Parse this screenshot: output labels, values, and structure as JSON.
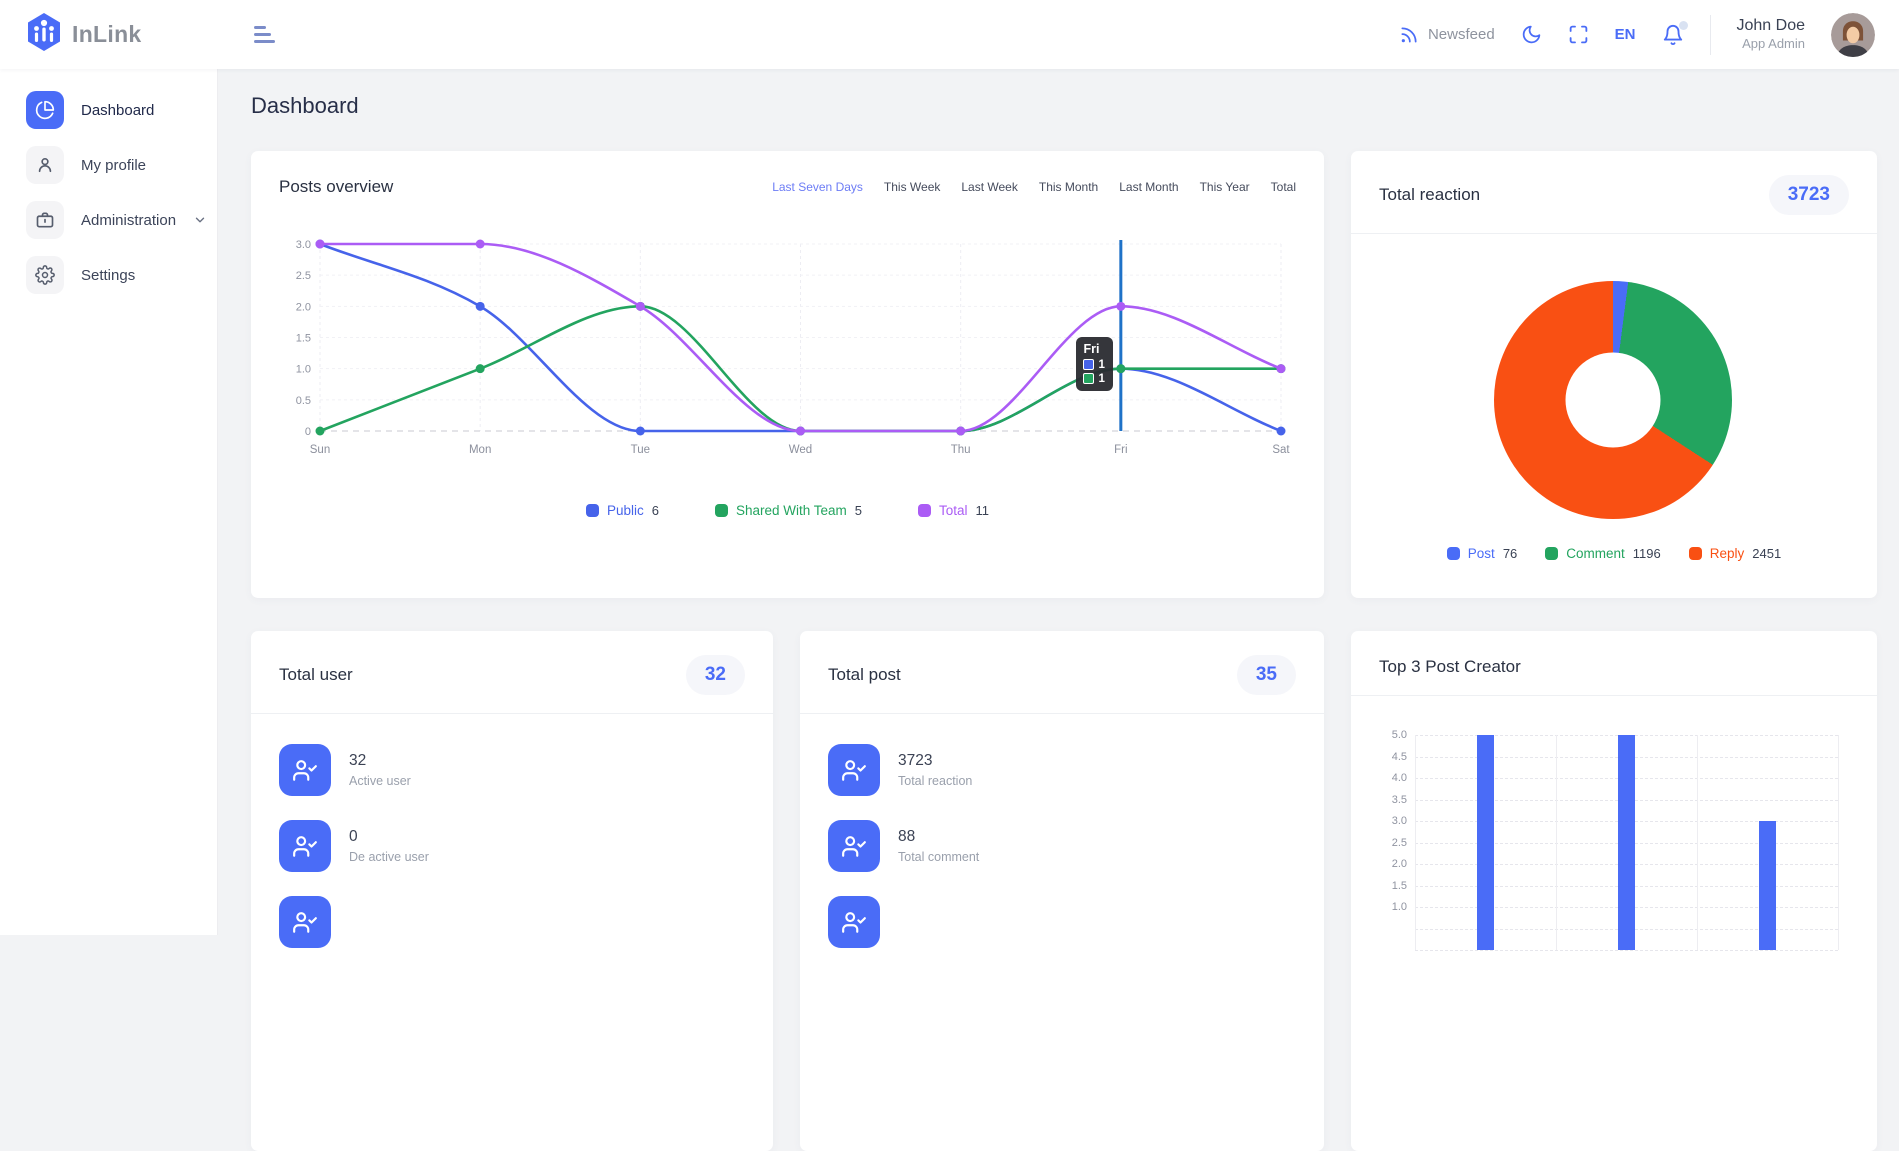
{
  "brand": {
    "name": "InLink"
  },
  "header": {
    "newsfeed_label": "Newsfeed",
    "language": "EN",
    "user": {
      "name": "John Doe",
      "role": "App Admin"
    }
  },
  "sidebar": {
    "items": [
      {
        "label": "Dashboard",
        "icon": "pie-chart-icon",
        "active": true,
        "has_submenu": false
      },
      {
        "label": "My profile",
        "icon": "user-icon",
        "active": false,
        "has_submenu": false
      },
      {
        "label": "Administration",
        "icon": "briefcase-icon",
        "active": false,
        "has_submenu": true
      },
      {
        "label": "Settings",
        "icon": "gear-icon",
        "active": false,
        "has_submenu": false
      }
    ]
  },
  "page": {
    "title": "Dashboard"
  },
  "posts_overview": {
    "title": "Posts overview",
    "filters": [
      {
        "label": "Last Seven Days",
        "active": true
      },
      {
        "label": "This Week",
        "active": false
      },
      {
        "label": "Last Week",
        "active": false
      },
      {
        "label": "This Month",
        "active": false
      },
      {
        "label": "Last Month",
        "active": false
      },
      {
        "label": "This Year",
        "active": false
      },
      {
        "label": "Total",
        "active": false
      }
    ],
    "chart_data": {
      "type": "line",
      "x": [
        "Sun",
        "Mon",
        "Tue",
        "Wed",
        "Thu",
        "Fri",
        "Sat"
      ],
      "series": [
        {
          "name": "Public",
          "color": "#4663ea",
          "values": [
            3,
            2,
            0,
            0,
            0,
            1,
            0
          ],
          "total": "6"
        },
        {
          "name": "Shared With Team",
          "color": "#23a45f",
          "values": [
            0,
            1,
            2,
            0,
            0,
            1,
            1
          ],
          "total": "5"
        },
        {
          "name": "Total",
          "color": "#ab5cf5",
          "values": [
            3,
            3,
            2,
            0,
            0,
            2,
            1
          ],
          "total": "11"
        }
      ],
      "yticks": [
        "3.0",
        "2.5",
        "2.0",
        "1.5",
        "1.0",
        "0.5",
        "0"
      ],
      "ylim": [
        0,
        3
      ],
      "grid": true,
      "legend_position": "bottom",
      "crosshair": {
        "x": "Fri",
        "color": "#1f72c8"
      },
      "tooltip": {
        "title": "Fri",
        "rows": [
          {
            "color": "#4663ea",
            "value": "1"
          },
          {
            "color": "#23a45f",
            "value": "1"
          }
        ]
      }
    }
  },
  "total_reaction": {
    "title": "Total reaction",
    "badge": "3723",
    "chart_data": {
      "type": "pie",
      "donut": true,
      "labels": [
        "Post",
        "Comment",
        "Reply"
      ],
      "values": [
        76,
        1196,
        2451
      ],
      "colors": [
        "#4a6cf7",
        "#23a45f",
        "#f95013"
      ],
      "legend_position": "bottom"
    }
  },
  "total_user": {
    "title": "Total user",
    "badge": "32",
    "rows": [
      {
        "value": "32",
        "label": "Active user"
      },
      {
        "value": "0",
        "label": "De active user"
      },
      {
        "value": "",
        "label": ""
      }
    ]
  },
  "total_post": {
    "title": "Total post",
    "badge": "35",
    "rows": [
      {
        "value": "3723",
        "label": "Total reaction"
      },
      {
        "value": "88",
        "label": "Total comment"
      },
      {
        "value": "",
        "label": ""
      }
    ]
  },
  "top_creators": {
    "title": "Top 3 Post Creator",
    "chart_data": {
      "type": "bar",
      "categories": [
        "",
        "",
        ""
      ],
      "values": [
        5,
        5,
        3
      ],
      "bar_color": "#4a6cf7",
      "yticks_visible": [
        "5.0",
        "4.5",
        "4.0",
        "3.5",
        "3.0",
        "2.5",
        "2.0",
        "1.5",
        "1.0"
      ],
      "ylim": [
        0,
        5
      ],
      "grid": true
    }
  },
  "colors": {
    "accent": "#4a6cf7",
    "page_bg": "#f2f3f5",
    "card_bg": "#ffffff"
  }
}
